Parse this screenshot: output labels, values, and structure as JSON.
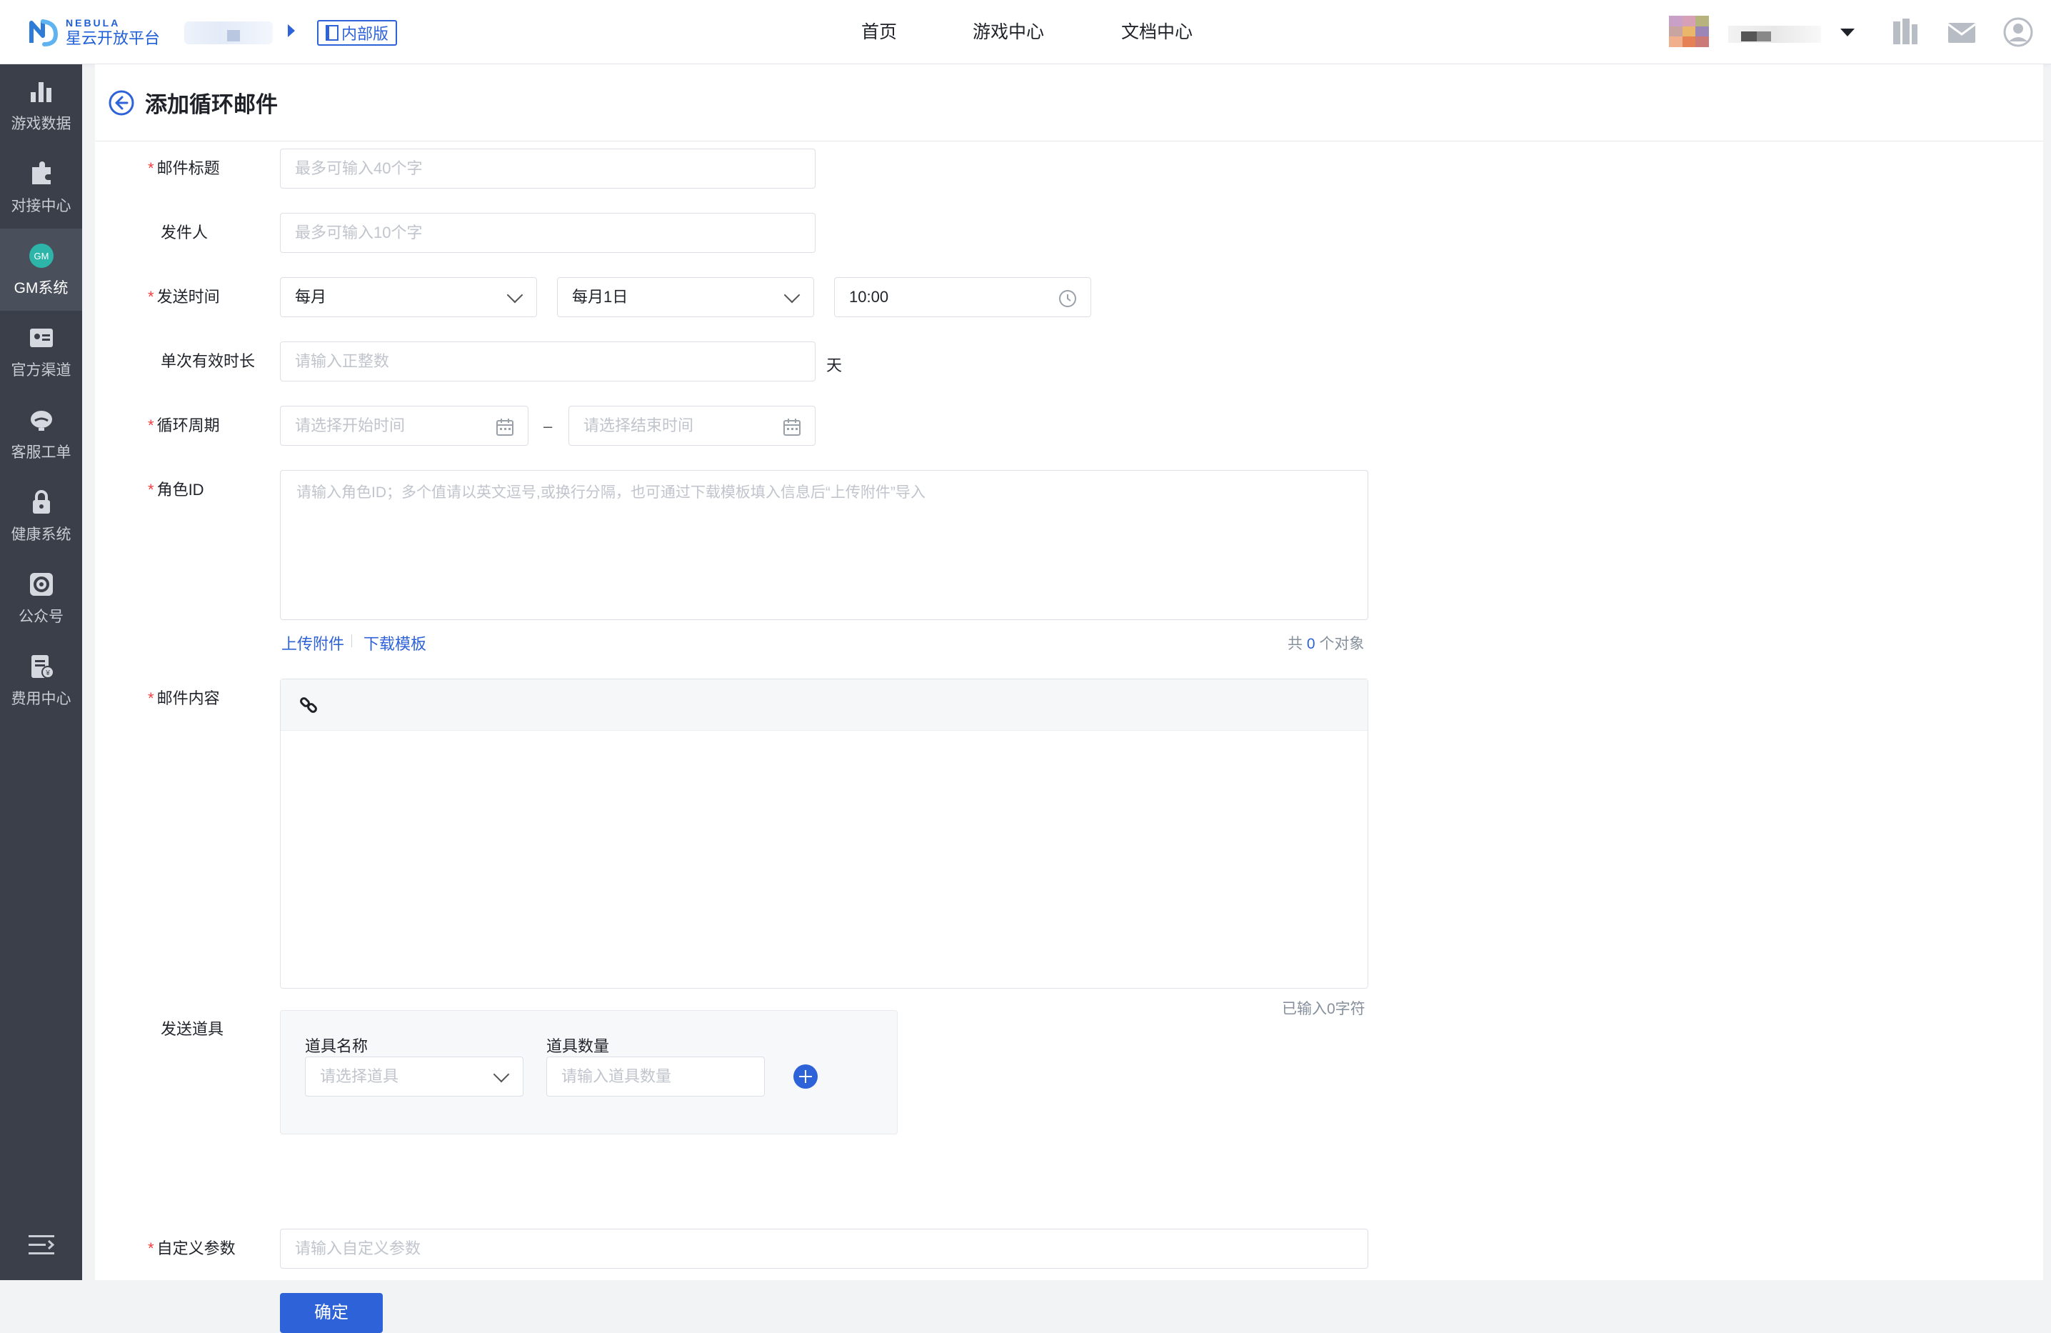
{
  "brand": {
    "en": "NEBULA",
    "cn": "星云开放平台"
  },
  "header": {
    "badge": "内部版",
    "nav": [
      "首页",
      "游戏中心",
      "文档中心"
    ]
  },
  "sidebar": {
    "items": [
      {
        "label": "游戏数据",
        "icon": "bar-chart-icon"
      },
      {
        "label": "对接中心",
        "icon": "puzzle-icon"
      },
      {
        "label": "GM系统",
        "icon": "gm-icon",
        "icon_text": "GM",
        "active": true
      },
      {
        "label": "官方渠道",
        "icon": "id-card-icon"
      },
      {
        "label": "客服工单",
        "icon": "headset-icon"
      },
      {
        "label": "健康系统",
        "icon": "lock-icon"
      },
      {
        "label": "公众号",
        "icon": "wechat-icon"
      },
      {
        "label": "费用中心",
        "icon": "bill-icon"
      }
    ]
  },
  "page": {
    "title": "添加循环邮件"
  },
  "form": {
    "title": {
      "label": "邮件标题",
      "placeholder": "最多可输入40个字"
    },
    "sender": {
      "label": "发件人",
      "placeholder": "最多可输入10个字"
    },
    "send_time": {
      "label": "发送时间",
      "frequency": "每月",
      "day": "每月1日",
      "time": "10:00"
    },
    "duration": {
      "label": "单次有效时长",
      "placeholder": "请输入正整数",
      "unit": "天"
    },
    "cycle": {
      "label": "循环周期",
      "start_placeholder": "请选择开始时间",
      "end_placeholder": "请选择结束时间",
      "separator": "–"
    },
    "role_id": {
      "label": "角色ID",
      "placeholder": "请输入角色ID；多个值请以英文逗号,或换行分隔，也可通过下载模板填入信息后“上传附件”导入",
      "upload": "上传附件",
      "download": "下载模板",
      "count_prefix": "共",
      "count": "0",
      "count_suffix": "个对象"
    },
    "content": {
      "label": "邮件内容",
      "char_count": "已输入0字符"
    },
    "items": {
      "label": "发送道具",
      "name_label": "道具名称",
      "name_placeholder": "请选择道具",
      "qty_label": "道具数量",
      "qty_placeholder": "请输入道具数量"
    },
    "custom": {
      "label": "自定义参数",
      "placeholder": "请输入自定义参数"
    },
    "submit": "确定"
  },
  "colors": {
    "primary": "#2e62d8",
    "required": "#f53f3f",
    "sidebar": "#3a3f49"
  }
}
